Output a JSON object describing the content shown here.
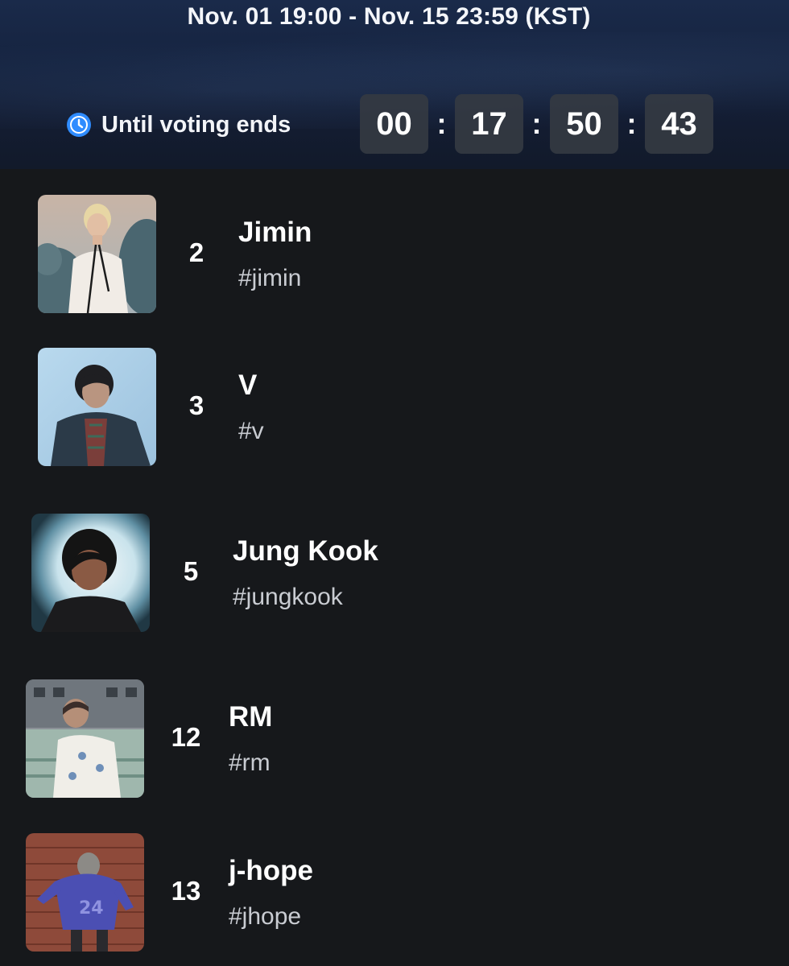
{
  "header": {
    "period": "Nov. 01 19:00 - Nov. 15 23:59 (KST)",
    "until_label": "Until voting ends",
    "countdown": [
      "00",
      "17",
      "50",
      "43"
    ],
    "separator": ":",
    "icon": "clock-icon",
    "accent_color": "#2f8cff"
  },
  "candidates": [
    {
      "rank": "2",
      "name": "Jimin",
      "tag": "#jimin",
      "photo": "jimin-photo"
    },
    {
      "rank": "3",
      "name": "V",
      "tag": "#v",
      "photo": "v-photo"
    },
    {
      "rank": "5",
      "name": "Jung Kook",
      "tag": "#jungkook",
      "photo": "jungkook-photo"
    },
    {
      "rank": "12",
      "name": "RM",
      "tag": "#rm",
      "photo": "rm-photo"
    },
    {
      "rank": "13",
      "name": "j-hope",
      "tag": "#jhope",
      "photo": "jhope-photo"
    }
  ]
}
